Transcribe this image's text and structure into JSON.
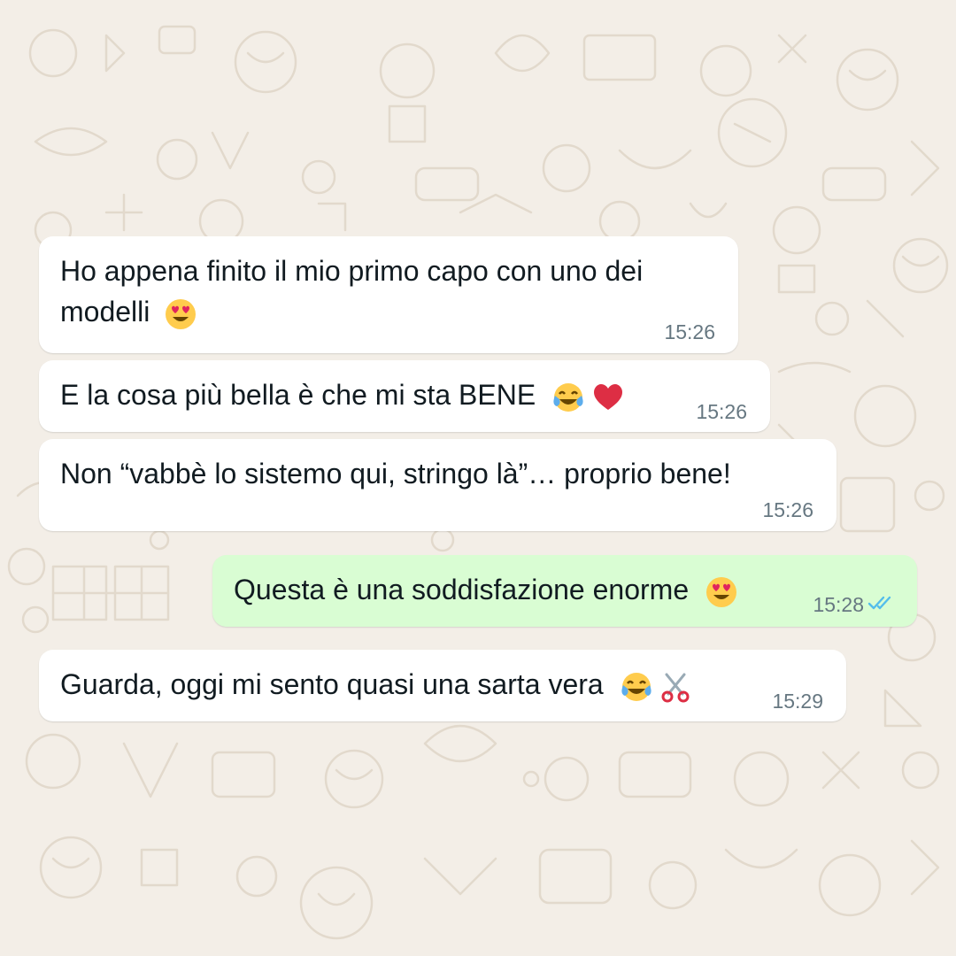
{
  "chat": {
    "messages": [
      {
        "direction": "incoming",
        "line1": "Ho appena finito il mio primo capo con uno dei",
        "line2": "modelli",
        "emoji": [
          "heart-eyes"
        ],
        "time": "15:26"
      },
      {
        "direction": "incoming",
        "line1": "E la cosa più bella è che mi sta BENE",
        "emoji": [
          "tears-of-joy",
          "red-heart"
        ],
        "time": "15:26"
      },
      {
        "direction": "incoming",
        "line1": "Non “vabbè lo sistemo qui, stringo là”… proprio bene!",
        "time": "15:26"
      },
      {
        "direction": "outgoing",
        "line1": "Questa è una soddisfazione enorme",
        "emoji": [
          "heart-eyes"
        ],
        "time": "15:28",
        "status": "read"
      },
      {
        "direction": "incoming",
        "line1": "Guarda, oggi mi sento quasi una sarta vera",
        "emoji": [
          "tears-of-joy",
          "scissors"
        ],
        "time": "15:29"
      }
    ]
  },
  "colors": {
    "incoming_bubble": "#ffffff",
    "outgoing_bubble": "#d9fdd3",
    "meta_text": "#667781",
    "read_ticks": "#53bdeb",
    "wallpaper": "#f3eee7"
  }
}
